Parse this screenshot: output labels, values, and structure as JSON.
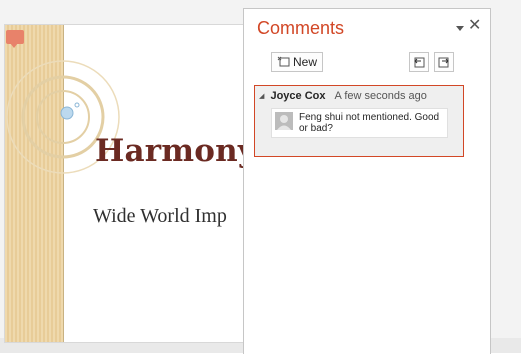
{
  "slide": {
    "title": "Harmony",
    "subtitle": "Wide World Imp"
  },
  "comments_pane": {
    "title": "Comments",
    "new_button_label": "New",
    "comments": [
      {
        "author": "Joyce Cox",
        "time": "A few seconds ago",
        "text": "Feng shui not mentioned. Good or bad?"
      }
    ]
  },
  "colors": {
    "accent": "#d24726",
    "title_text": "#6b2a22"
  },
  "icons": {
    "pane_menu": "dropdown-arrow-icon",
    "close": "close-icon",
    "new_comment": "new-comment-icon",
    "previous": "previous-comment-icon",
    "next": "next-comment-icon"
  }
}
